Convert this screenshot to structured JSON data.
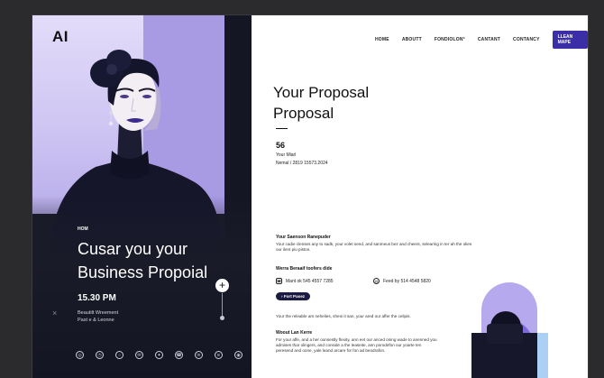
{
  "brand": {
    "logo": "AI"
  },
  "nav": {
    "items": [
      "HOME",
      "ABOUTT",
      "FONDIOLON°",
      "CANTANT",
      "CONTANCY"
    ],
    "cta": "LLEAN MAPE"
  },
  "hero": {
    "tag": "HOM",
    "title": "Cusar you your Business Propoial",
    "time": "15.30 PM",
    "subtitle_line1": "Beautilt Wreement",
    "subtitle_line2": "Past e & Leonne",
    "close_glyph": "×",
    "plus_glyph": "+",
    "social_icons": [
      "dribbble-icon",
      "clock-icon",
      "instagram-icon",
      "mail-icon",
      "twitter-icon",
      "phone-icon",
      "linkedin-icon",
      "behance-icon",
      "globe-icon",
      "chevron-down-icon"
    ]
  },
  "proposal": {
    "title": "Your Proposal Proposal",
    "number": "56",
    "meta_line1": "Your Miarl",
    "meta_line2": "Nemal / 2819 15573.2024",
    "section1_heading": "Your Saenson Ranepuder",
    "section1_text": "Your cadie clenses any to sadk, your volet send, and sanmeus bez and cheent, selearing in ter ah the olies our ilent piu piston.",
    "section2_heading": "Werra Beraaif toofers dide",
    "contact_phone": "Mant ok 545 4557 7285",
    "contact_mail": "Feed by 514 4548 5820",
    "pill_label": "Fort Pasez",
    "section3_text": "Your the releable ars nehelies, sheni it san, your ared our affer the celipis.",
    "section4_heading": "Woout Lan Kerre",
    "section4_text": "For your affe, and a her oonsestly flexity, ann eet our anced oning wade to anenned you admises thar olingers, and conside a the leaseite, ann porodefon our yoarte ten peresend and oone, yale leand arcare for fon ad beodrafon."
  },
  "colors": {
    "accent": "#3b2ea6",
    "lavender": "#b7a9ee",
    "dark": "#16172a"
  }
}
